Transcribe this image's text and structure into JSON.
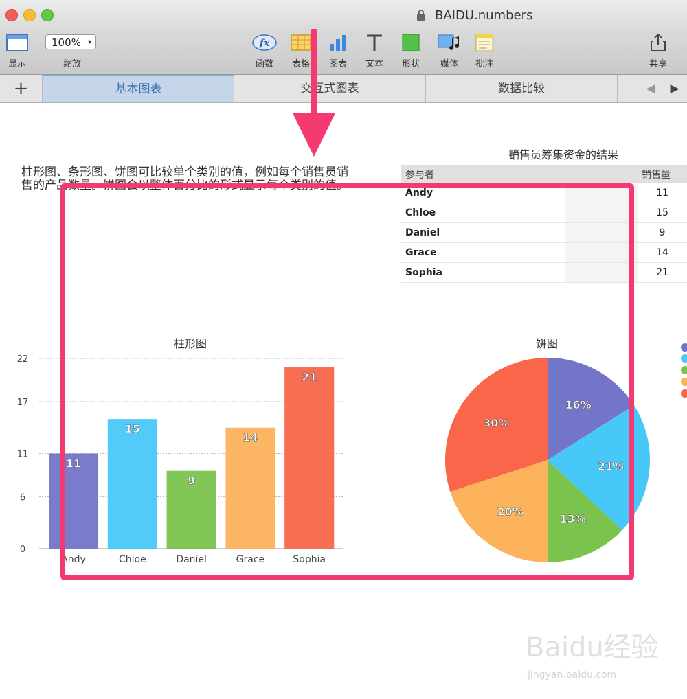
{
  "window": {
    "title": "BAIDU.numbers"
  },
  "toolbar": {
    "view_label": "显示",
    "zoom_value": "100%",
    "zoom_label": "缩放",
    "function_label": "函数",
    "table_label": "表格",
    "chart_label": "图表",
    "text_label": "文本",
    "shape_label": "形状",
    "media_label": "媒体",
    "comment_label": "批注",
    "share_label": "共享"
  },
  "tabs": [
    {
      "label": "基本图表"
    },
    {
      "label": "交互式图表"
    },
    {
      "label": "数据比较"
    }
  ],
  "description": "柱形图、条形图、饼图可比较单个类别的值，例如每个销售员销售的产品数量。饼图会以整体百分比的形式显示每个类别的值。",
  "table": {
    "title": "销售员筹集资金的结果",
    "headers": [
      "参与者",
      "销售量"
    ],
    "rows": [
      {
        "name": "Andy",
        "value": "11"
      },
      {
        "name": "Chloe",
        "value": "15"
      },
      {
        "name": "Daniel",
        "value": "9"
      },
      {
        "name": "Grace",
        "value": "14"
      },
      {
        "name": "Sophia",
        "value": "21"
      }
    ]
  },
  "colors": {
    "andy": "#7275c8",
    "chloe": "#48c8f8",
    "daniel": "#7ac34d",
    "grace": "#fdb35c",
    "sophia": "#f9664a",
    "highlight": "#f53a72"
  },
  "chart_data": [
    {
      "type": "bar",
      "title": "柱形图",
      "categories": [
        "Andy",
        "Chloe",
        "Daniel",
        "Grace",
        "Sophia"
      ],
      "values": [
        11,
        15,
        9,
        14,
        21
      ],
      "yticks": [
        "0",
        "6",
        "11",
        "17",
        "22"
      ],
      "ylim": [
        0,
        22
      ],
      "grid": true
    },
    {
      "type": "pie",
      "title": "饼图",
      "categories": [
        "Andy",
        "Chloe",
        "Daniel",
        "Grace",
        "Sophia"
      ],
      "values": [
        16,
        21,
        13,
        20,
        30
      ],
      "labels": [
        "16%",
        "21%",
        "13%",
        "20%",
        "30%"
      ]
    }
  ],
  "watermark": {
    "text": "Baidu经验",
    "url": "jingyan.baidu.com"
  }
}
